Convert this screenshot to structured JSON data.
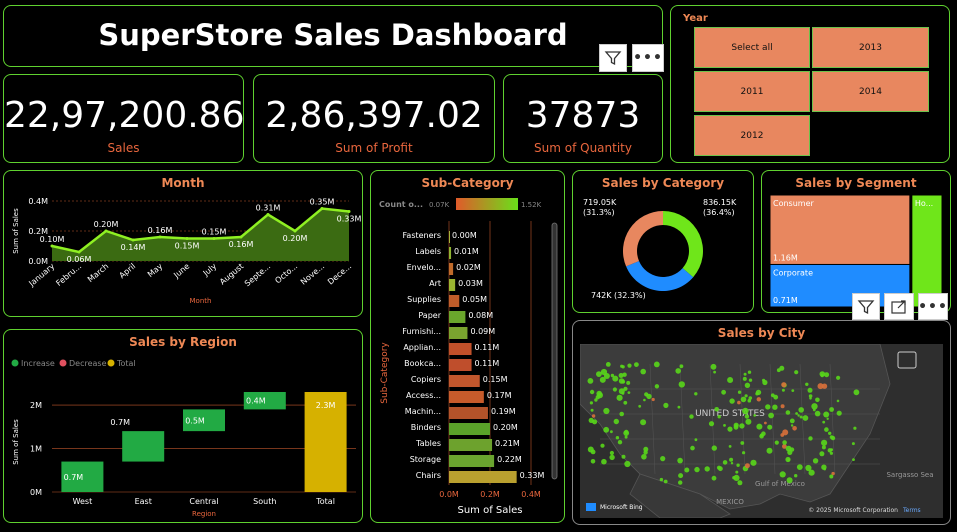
{
  "header": {
    "title": "SuperStore Sales Dashboard"
  },
  "kpis": [
    {
      "value": "22,97,200.86",
      "label": "Sales"
    },
    {
      "value": "2,86,397.02",
      "label": "Sum of Profit"
    },
    {
      "value": "37873",
      "label": "Sum of Quantity"
    }
  ],
  "year_slicer": {
    "title": "Year",
    "options": [
      "Select all",
      "2013",
      "2011",
      "2014",
      "2012"
    ]
  },
  "colors": {
    "accent_border": "#5fd12f",
    "title_orange": "#ee8855",
    "green": "#22aa44",
    "gold": "#d6b100"
  },
  "month_chart": {
    "title": "Month",
    "chart_data": {
      "type": "area",
      "categories": [
        "January",
        "Febru...",
        "March",
        "April",
        "May",
        "June",
        "July",
        "August",
        "Septe...",
        "Octo...",
        "Nove...",
        "Dece..."
      ],
      "values": [
        0.1,
        0.06,
        0.2,
        0.14,
        0.16,
        0.15,
        0.15,
        0.16,
        0.31,
        0.2,
        0.35,
        0.33
      ],
      "labels": [
        "0.10M",
        "0.06M",
        "0.20M",
        "0.14M",
        "0.16M",
        "0.15M",
        "0.15M",
        "0.16M",
        "0.31M",
        "0.20M",
        "0.35M",
        "0.33M"
      ],
      "xlabel": "Month",
      "ylabel": "Sum of Sales",
      "yticks": [
        "0.0M",
        "0.2M",
        "0.4M"
      ],
      "ylim": [
        0,
        0.4
      ]
    }
  },
  "subcat_chart": {
    "title": "Sub-Category",
    "legend_title": "Count o...",
    "legend_min": "0.07K",
    "legend_max": "1.52K",
    "chart_data": {
      "type": "bar",
      "categories": [
        "Fasteners",
        "Labels",
        "Envelo...",
        "Art",
        "Supplies",
        "Paper",
        "Furnishi...",
        "Applian...",
        "Bookca...",
        "Copiers",
        "Access...",
        "Machin...",
        "Binders",
        "Tables",
        "Storage",
        "Chairs"
      ],
      "values": [
        0.0,
        0.01,
        0.02,
        0.03,
        0.05,
        0.08,
        0.09,
        0.11,
        0.11,
        0.15,
        0.17,
        0.19,
        0.2,
        0.21,
        0.22,
        0.33
      ],
      "labels": [
        "0.00M",
        "0.01M",
        "0.02M",
        "0.03M",
        "0.05M",
        "0.08M",
        "0.09M",
        "0.11M",
        "0.11M",
        "0.15M",
        "0.17M",
        "0.19M",
        "0.20M",
        "0.21M",
        "0.22M",
        "0.33M"
      ],
      "colors": [
        "#a4b33a",
        "#8fb432",
        "#c06a2a",
        "#9ab531",
        "#c05d2a",
        "#6aa62c",
        "#7aa42f",
        "#c0502a",
        "#bf4e2c",
        "#c2572d",
        "#c75b2b",
        "#b4532a",
        "#5aa22a",
        "#6da22d",
        "#6aa42f",
        "#b9a02f"
      ],
      "xlabel": "Sum of Sales",
      "ylabel": "Sub-Category",
      "xticks": [
        "0.0M",
        "0.2M",
        "0.4M"
      ],
      "xlim": [
        0,
        0.4
      ]
    }
  },
  "category_chart": {
    "title": "Sales by Category",
    "chart_data": {
      "type": "pie",
      "categories": [
        "Technology",
        "Furniture",
        "Office Supplies"
      ],
      "values": [
        836.15,
        742,
        719.05
      ],
      "labels": [
        "836.15K\n(36.4%)",
        "742K (32.3%)",
        "719.05K\n(31.3%)"
      ],
      "colors": [
        "#6fe61a",
        "#1f8cff",
        "#e8875f"
      ]
    }
  },
  "segment_chart": {
    "title": "Sales by Segment",
    "chart_data": {
      "type": "treemap",
      "categories": [
        "Consumer",
        "Corporate",
        "Ho..."
      ],
      "values": [
        1.16,
        0.71,
        0.43
      ],
      "labels": [
        "1.16M",
        "0.71M",
        ""
      ],
      "colors": [
        "#e8875f",
        "#1f8cff",
        "#6fe61a"
      ]
    }
  },
  "region_chart": {
    "title": "Sales by Region",
    "legend": [
      "Increase",
      "Decrease",
      "Total"
    ],
    "legend_colors": [
      "#22aa44",
      "#e0505f",
      "#d6b100"
    ],
    "chart_data": {
      "type": "waterfall",
      "categories": [
        "West",
        "East",
        "Central",
        "South",
        "Total"
      ],
      "values": [
        0.7,
        0.7,
        0.5,
        0.4,
        2.3
      ],
      "labels": [
        "0.7M",
        "0.7M",
        "0.5M",
        "0.4M",
        "2.3M"
      ],
      "xlabel": "Region",
      "ylabel": "Sum of Sales",
      "yticks": [
        "0M",
        "1M",
        "2M"
      ],
      "ylim": [
        0,
        2.3
      ]
    }
  },
  "city_map": {
    "title": "Sales by City",
    "country_label": "UNITED STATES",
    "mexico_label": "MEXICO",
    "gulf_label": "Gulf of Mexico",
    "sea_label": "Sargasso Sea",
    "copyright": "© 2025 Microsoft Corporation",
    "terms": "Terms",
    "bing": "Microsoft Bing"
  },
  "toolbar_icons": [
    "filter-icon",
    "more-options-icon",
    "focus-mode-icon"
  ]
}
